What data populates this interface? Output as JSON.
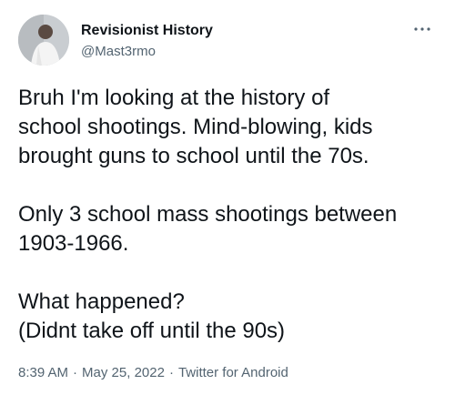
{
  "tweet": {
    "author": {
      "display_name": "Revisionist History",
      "handle": "@Mast3rmo",
      "avatar_icon": "user-avatar"
    },
    "more_icon": "more-horizontal-icon",
    "paragraphs": [
      "Bruh I'm looking at the history of\nschool shootings. Mind-blowing, kids\nbrought guns to school until the 70s.",
      "Only 3 school mass shootings between\n1903-1966.",
      "What happened?\n(Didnt take off until the 90s)"
    ],
    "time": "8:39 AM",
    "date": "May 25, 2022",
    "source": "Twitter for Android",
    "separator": "·"
  },
  "colors": {
    "text_primary": "#0f1419",
    "text_secondary": "#536471",
    "background": "#ffffff"
  }
}
